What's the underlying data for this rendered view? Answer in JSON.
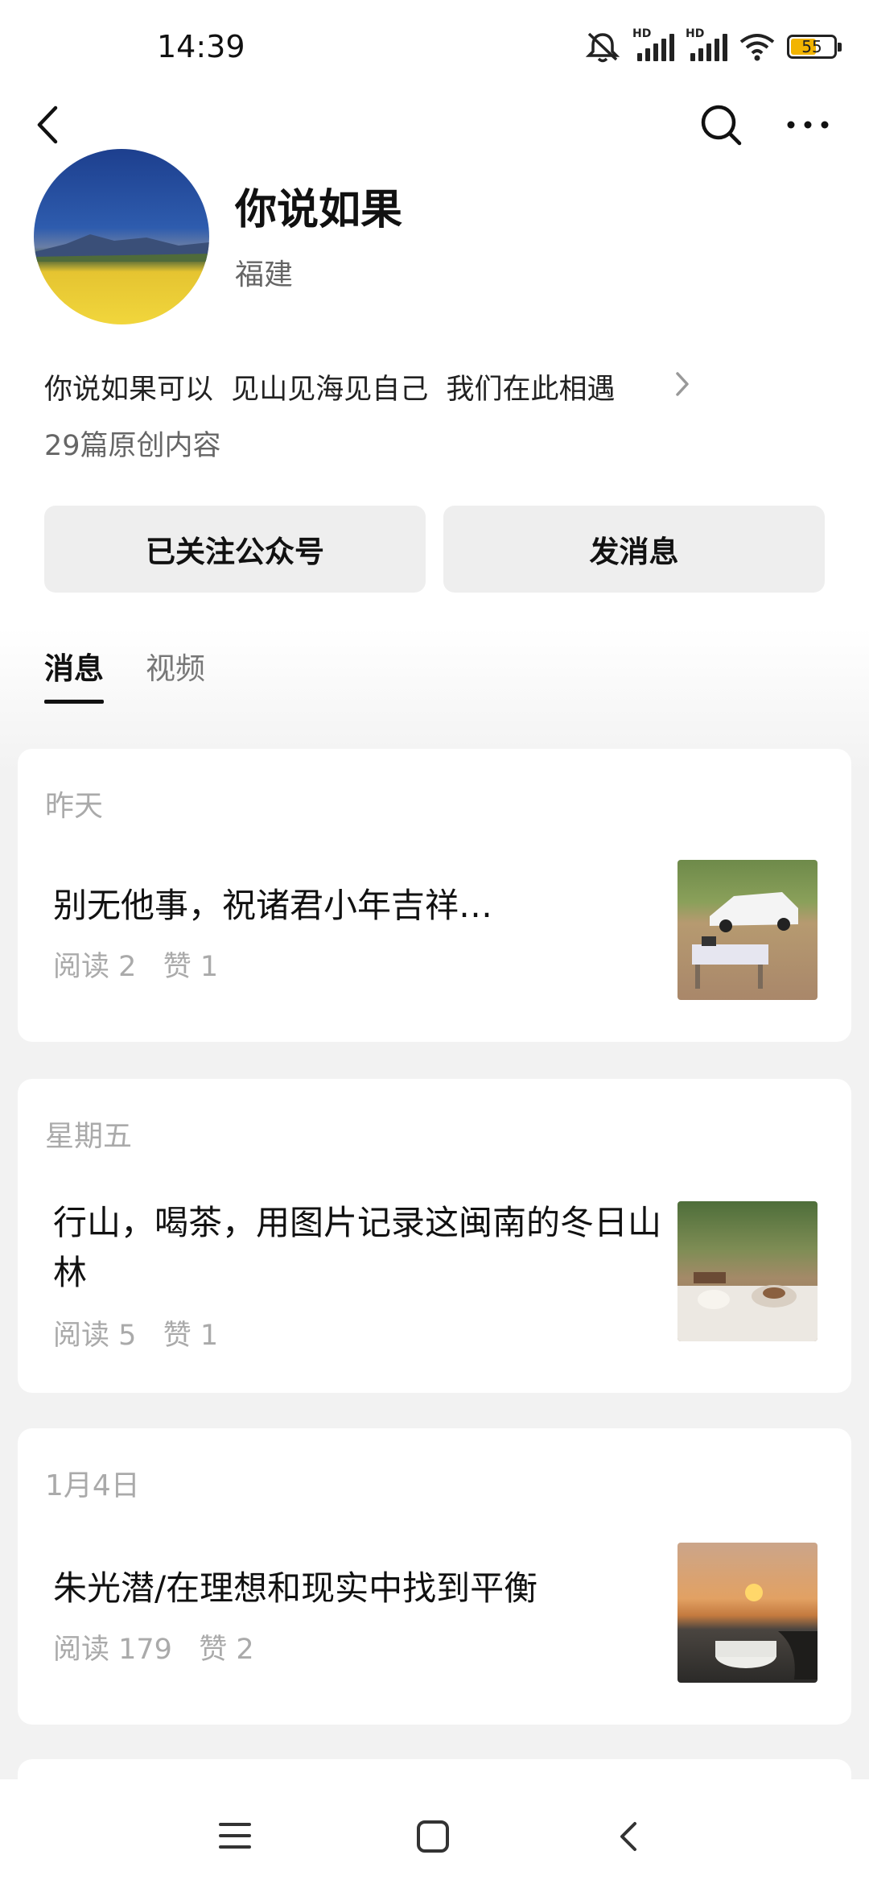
{
  "status_bar": {
    "time": "14:39",
    "battery": "55",
    "signal_label": "HD"
  },
  "nav": {
    "back_icon": "back-icon",
    "search_icon": "search-icon",
    "more_icon": "more-icon"
  },
  "profile": {
    "name": "你说如果",
    "region": "福建",
    "bio": "你说如果可以  见山见海见自己  我们在此相遇",
    "count": "29篇原创内容"
  },
  "actions": {
    "follow_label": "已关注公众号",
    "message_label": "发消息"
  },
  "tabs": [
    {
      "label": "消息"
    },
    {
      "label": "视频"
    }
  ],
  "articles": [
    {
      "date": "昨天",
      "title": "别无他事，祝诸君小年吉祥…",
      "stats": "阅读 2   赞 1"
    },
    {
      "date": "星期五",
      "title": "行山，喝茶，用图片记录这闽南的冬日山林",
      "stats": "阅读 5   赞 1"
    },
    {
      "date": "1月4日",
      "title": "朱光潜/在理想和现实中找到平衡",
      "stats": "阅读 179   赞 2"
    }
  ],
  "colors": {
    "accent_text": "#111111",
    "muted_text": "#aaaaaa",
    "battery_fill": "#f2b400"
  }
}
